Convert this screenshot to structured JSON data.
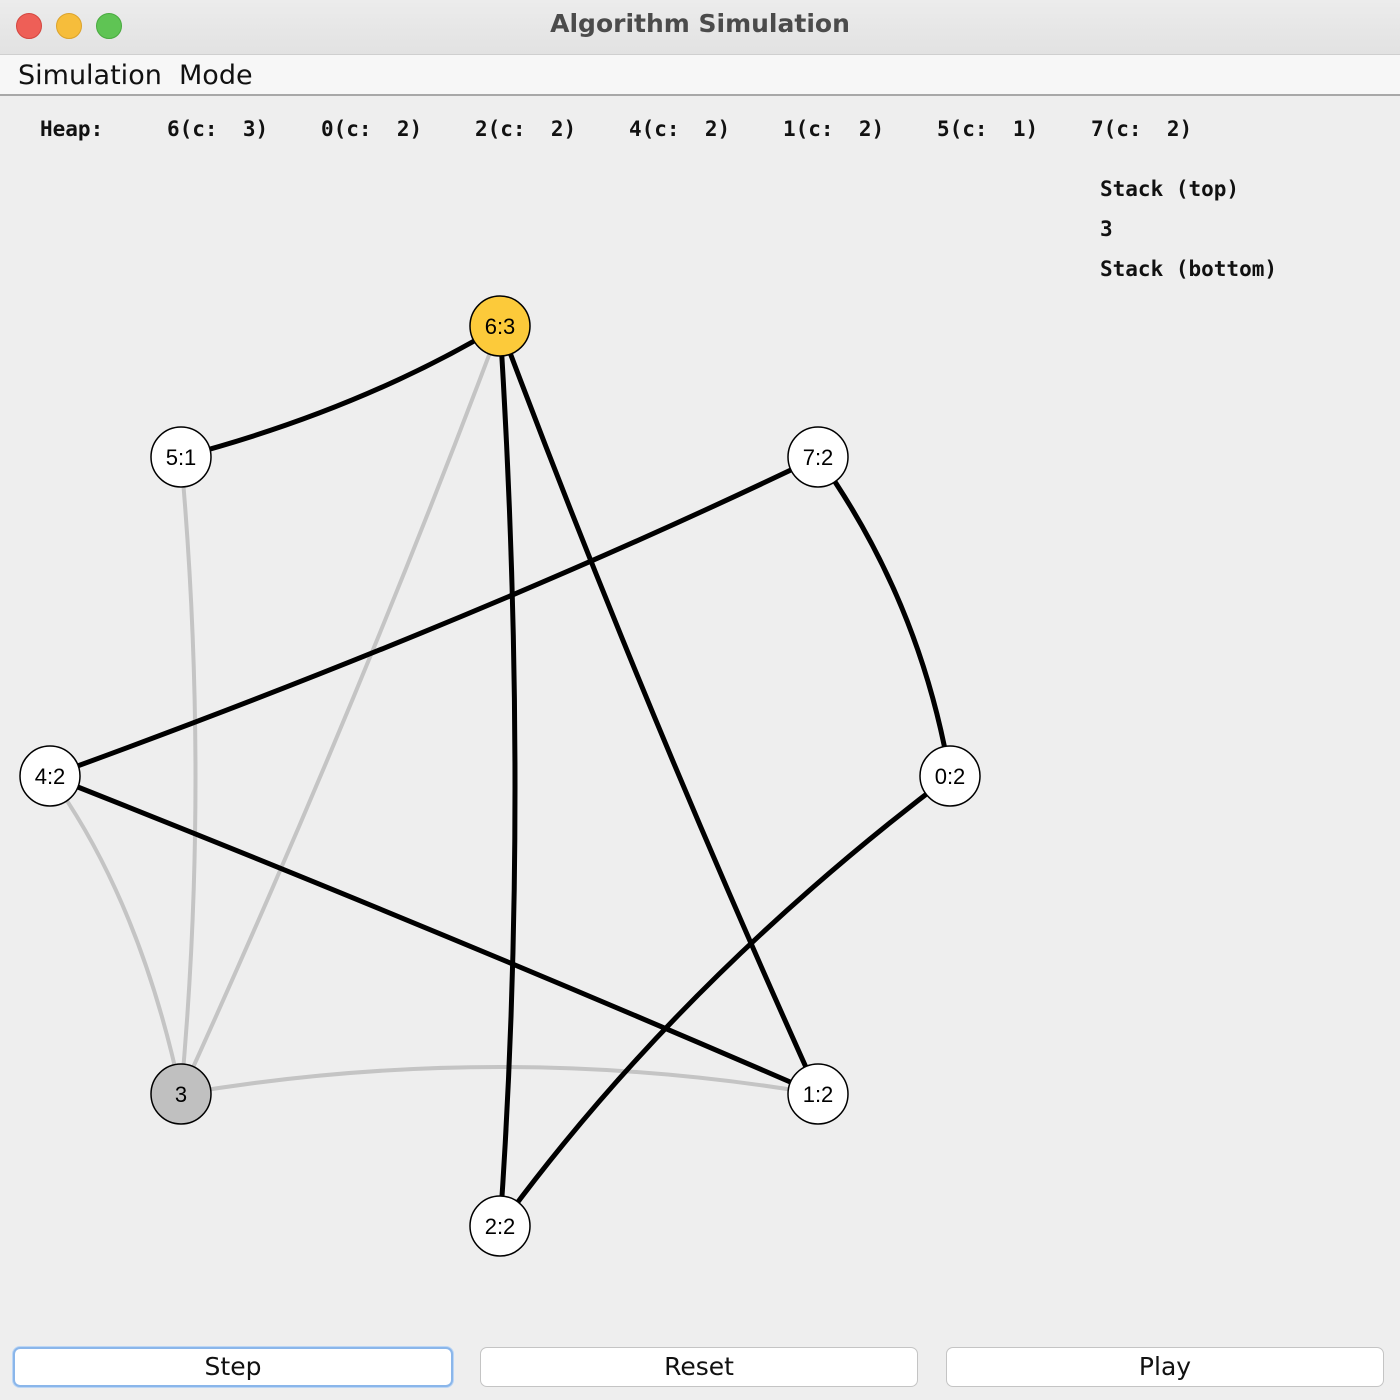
{
  "window": {
    "title": "Algorithm Simulation"
  },
  "menu": {
    "simulation": "Simulation",
    "mode": "Mode"
  },
  "heap": {
    "label": "Heap:",
    "entries": [
      {
        "text": "6(c:  3)"
      },
      {
        "text": "0(c:  2)"
      },
      {
        "text": "2(c:  2)"
      },
      {
        "text": "4(c:  2)"
      },
      {
        "text": "1(c:  2)"
      },
      {
        "text": "5(c:  1)"
      },
      {
        "text": "7(c:  2)"
      }
    ]
  },
  "stack": {
    "top_label": "Stack (top)",
    "items": [
      "3"
    ],
    "bottom_label": "Stack (bottom)"
  },
  "graph": {
    "colors": {
      "highlight": "#fcca3a",
      "processed": "#c0c0c0",
      "default": "#ffffff",
      "active_edge": "#000000",
      "inactive_edge": "#c4c4c4"
    },
    "nodes": [
      {
        "id": "6",
        "label": "6:3",
        "state": "highlight"
      },
      {
        "id": "5",
        "label": "5:1",
        "state": "default"
      },
      {
        "id": "7",
        "label": "7:2",
        "state": "default"
      },
      {
        "id": "4",
        "label": "4:2",
        "state": "default"
      },
      {
        "id": "0",
        "label": "0:2",
        "state": "default"
      },
      {
        "id": "3",
        "label": "3",
        "state": "processed"
      },
      {
        "id": "1",
        "label": "1:2",
        "state": "default"
      },
      {
        "id": "2",
        "label": "2:2",
        "state": "default"
      }
    ],
    "edges": [
      {
        "from": "5",
        "to": "6",
        "active": true
      },
      {
        "from": "6",
        "to": "2",
        "active": true
      },
      {
        "from": "6",
        "to": "1",
        "active": true
      },
      {
        "from": "7",
        "to": "4",
        "active": true
      },
      {
        "from": "7",
        "to": "0",
        "active": true
      },
      {
        "from": "4",
        "to": "1",
        "active": true
      },
      {
        "from": "0",
        "to": "2",
        "active": true
      },
      {
        "from": "5",
        "to": "3",
        "active": false
      },
      {
        "from": "6",
        "to": "3",
        "active": false
      },
      {
        "from": "4",
        "to": "3",
        "active": false
      },
      {
        "from": "3",
        "to": "1",
        "active": false
      }
    ]
  },
  "buttons": {
    "step": "Step",
    "reset": "Reset",
    "play": "Play"
  }
}
